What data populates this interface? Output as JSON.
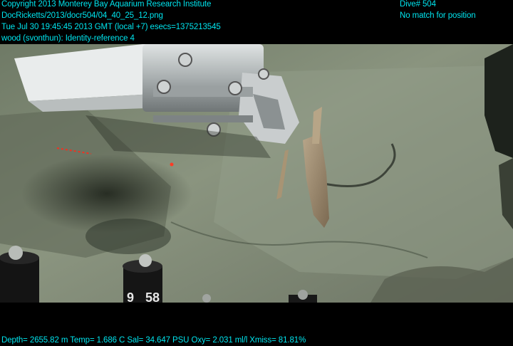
{
  "overlay": {
    "top_left_lines": [
      "Copyright 2013 Monterey Bay Aquarium Research Institute",
      "DocRicketts/2013/docr504/04_40_25_12.png",
      "Tue Jul 30 19:45:45 2013 GMT (local +7)  esecs=1375213545",
      "wood (svonthun): Identity-reference 4"
    ],
    "top_right_lines": [
      "Dive# 504",
      "No match for position"
    ],
    "bottom_line": "Depth= 2655.82 m  Temp= 1.686 C  Sal= 34.647 PSU  Oxy= 2.031 ml/l  Xmiss= 81.81%"
  },
  "scene": {
    "subject": "ROV manipulator claw grasping a piece of wood on seafloor sediment",
    "marker_labels": [
      "9",
      "58"
    ]
  },
  "colors": {
    "overlay_text": "#00e5ef",
    "sediment": "#7f8a78",
    "laser": "#ff2a1a"
  }
}
